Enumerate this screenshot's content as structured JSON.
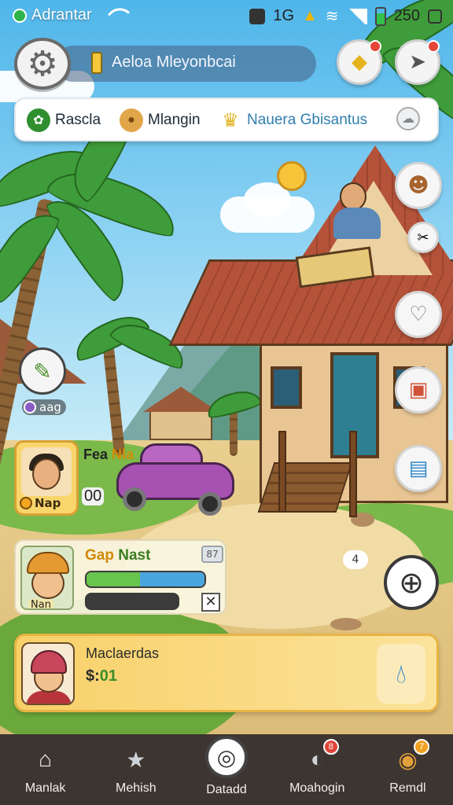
{
  "status_bar": {
    "carrier": "Adrantar",
    "indicator_text": "1G",
    "time": "250"
  },
  "profile": {
    "player_name": "Aeloa Mleyonbcai"
  },
  "resources": [
    {
      "label": "Rascla",
      "icon": "leaf-icon",
      "color": "#2f8f2f"
    },
    {
      "label": "Mlangin",
      "icon": "cookie-icon",
      "color": "#d88b2b"
    },
    {
      "label": "Nauera Gbisantus",
      "icon": "crown-icon",
      "color": "#e0b320"
    }
  ],
  "map_marker": {
    "label": "aag"
  },
  "quest": {
    "title_black": "Fea ",
    "title_yellow": "Nla",
    "tag": "Nap",
    "count": "00"
  },
  "task": {
    "title_yellow": "Gap ",
    "title_green": "Nast",
    "badge": "87",
    "portrait_tag": "Nan",
    "progress_green": 0.45,
    "progress_blue": 0.55
  },
  "reward": {
    "title": "Maclaerdas",
    "amount_prefix": "$:",
    "amount_value": "01"
  },
  "chat": {
    "label": "4"
  },
  "bottom_nav": [
    {
      "label": "Manlak",
      "icon": "home-icon"
    },
    {
      "label": "Mehish",
      "icon": "star-icon"
    },
    {
      "label": "Datadd",
      "icon": "disc-icon"
    },
    {
      "label": "Moahogin",
      "icon": "search-icon",
      "badge": "8",
      "badge_color": "#e0453a"
    },
    {
      "label": "Remdl",
      "icon": "coin-icon",
      "badge": "7",
      "badge_color": "#f0a020"
    }
  ],
  "colors": {
    "accent": "#f8d068",
    "nav_bg": "#3d3531",
    "progress_green": "#68c44c",
    "progress_blue": "#4aa6dc"
  }
}
